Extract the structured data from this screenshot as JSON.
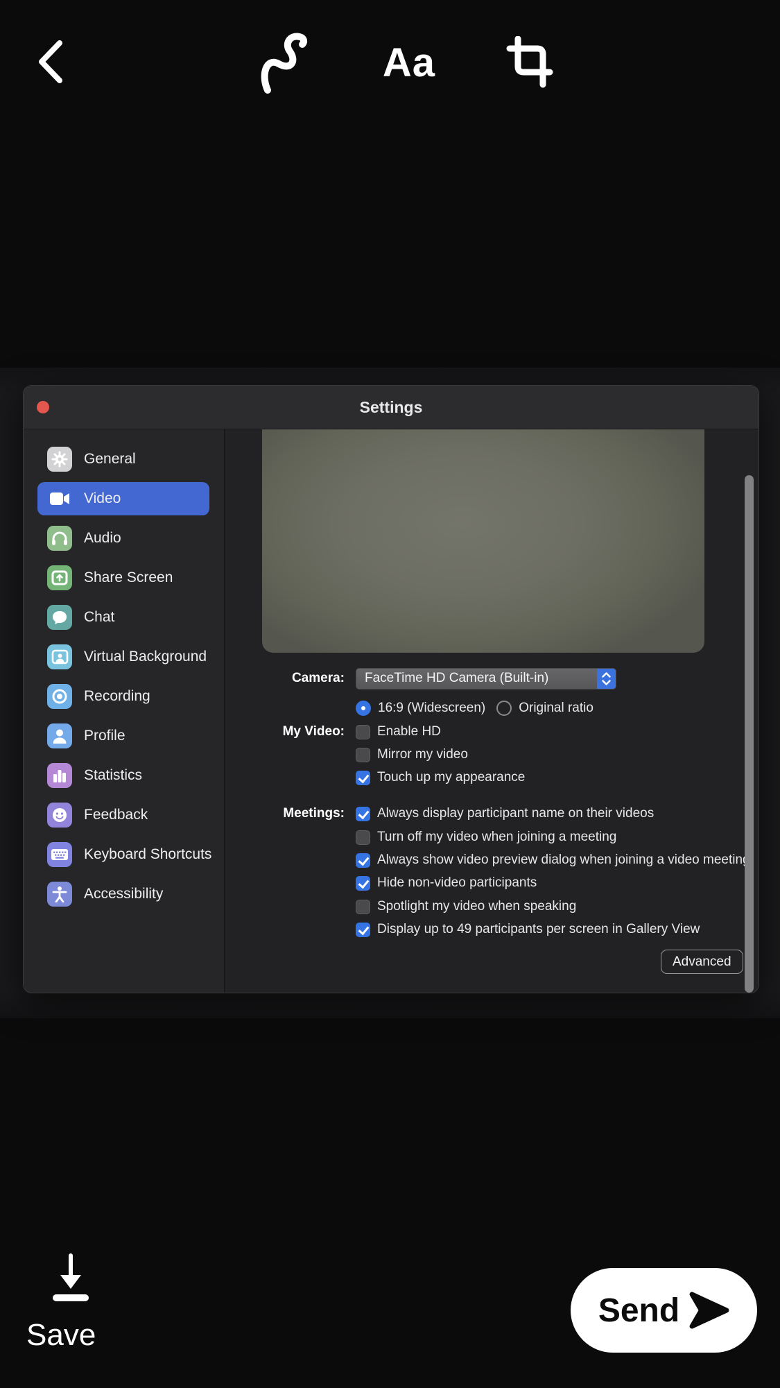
{
  "colors": {
    "selected_row_blue": "#4468d2",
    "control_blue": "#3574e2",
    "stepper_blue": "#3b72dd",
    "close_dot_red": "#e4574e"
  },
  "toolbar": {
    "text_tool_label": "Aa"
  },
  "window": {
    "title": "Settings",
    "sidebar": {
      "items": [
        {
          "label": "General",
          "color": "#d2d2d4",
          "selected": false
        },
        {
          "label": "Video",
          "color": "transparent",
          "selected": true
        },
        {
          "label": "Audio",
          "color": "#8fbe8c",
          "selected": false
        },
        {
          "label": "Share Screen",
          "color": "#74b577",
          "selected": false
        },
        {
          "label": "Chat",
          "color": "#63a8a2",
          "selected": false
        },
        {
          "label": "Virtual Background",
          "color": "#79c3de",
          "selected": false
        },
        {
          "label": "Recording",
          "color": "#6fb0e6",
          "selected": false
        },
        {
          "label": "Profile",
          "color": "#74a9ea",
          "selected": false
        },
        {
          "label": "Statistics",
          "color": "#b488d4",
          "selected": false
        },
        {
          "label": "Feedback",
          "color": "#9184da",
          "selected": false
        },
        {
          "label": "Keyboard Shortcuts",
          "color": "#8183e0",
          "selected": false
        },
        {
          "label": "Accessibility",
          "color": "#7d8ad8",
          "selected": false
        }
      ]
    },
    "content": {
      "camera": {
        "label": "Camera:",
        "value": "FaceTime HD Camera (Built-in)"
      },
      "aspect": {
        "options": [
          {
            "label": "16:9 (Widescreen)",
            "selected": true
          },
          {
            "label": "Original ratio",
            "selected": false
          }
        ]
      },
      "my_video": {
        "label": "My Video:",
        "items": [
          {
            "label": "Enable HD",
            "checked": false
          },
          {
            "label": "Mirror my video",
            "checked": false
          },
          {
            "label": "Touch up my appearance",
            "checked": true
          }
        ]
      },
      "meetings": {
        "label": "Meetings:",
        "items": [
          {
            "label": "Always display participant name on their videos",
            "checked": true
          },
          {
            "label": "Turn off my video when joining a meeting",
            "checked": false
          },
          {
            "label": "Always show video preview dialog when joining a video meeting",
            "checked": true
          },
          {
            "label": "Hide non-video participants",
            "checked": true
          },
          {
            "label": "Spotlight my video when speaking",
            "checked": false
          },
          {
            "label": "Display up to 49 participants per screen in Gallery View",
            "checked": true
          }
        ]
      },
      "advanced_label": "Advanced"
    }
  },
  "footer": {
    "save_label": "Save",
    "send_label": "Send"
  }
}
